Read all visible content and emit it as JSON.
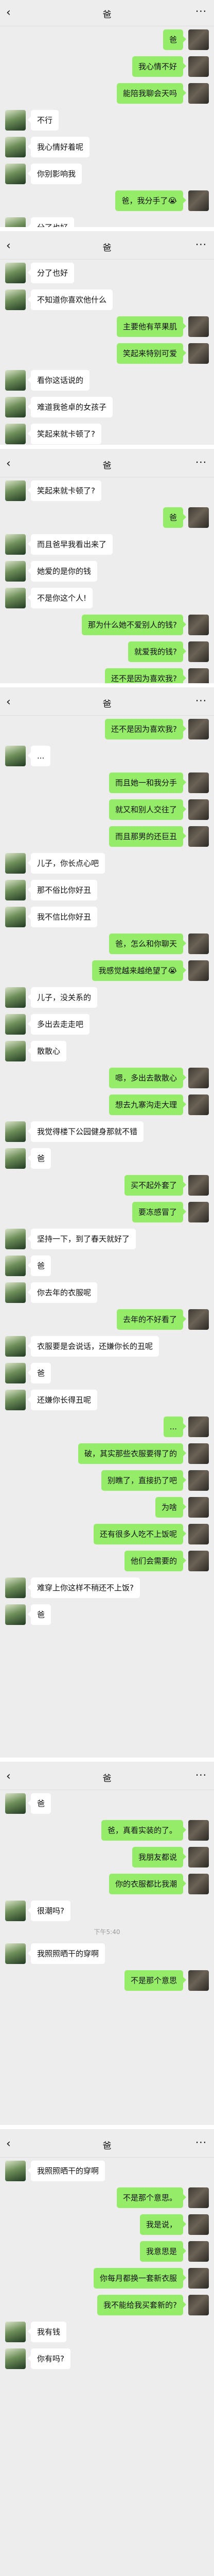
{
  "contact_name": "爸",
  "back_icon": "back-chevron-icon",
  "more_icon": "more-dots-icon",
  "screens": [
    {
      "messages": [
        {
          "side": "right",
          "text": "爸"
        },
        {
          "side": "right",
          "text": "我心情不好"
        },
        {
          "side": "right",
          "text": "能陪我聊会天吗"
        },
        {
          "side": "left",
          "text": "不行"
        },
        {
          "side": "left",
          "text": "我心情好着呢"
        },
        {
          "side": "left",
          "text": "你别影响我"
        },
        {
          "side": "right",
          "text": "爸，我分手了😭"
        },
        {
          "side": "left",
          "text": "分了也好"
        }
      ]
    },
    {
      "messages": [
        {
          "side": "left",
          "text": "分了也好"
        },
        {
          "side": "left",
          "text": "不知道你喜欢他什么"
        },
        {
          "side": "right",
          "text": "主要他有苹果肌"
        },
        {
          "side": "right",
          "text": "笑起来特别可爱"
        },
        {
          "side": "left",
          "text": "看你这话说的"
        },
        {
          "side": "left",
          "text": "难道我爸卓的女孩子"
        },
        {
          "side": "left",
          "text": "笑起来就卡顿了?"
        }
      ]
    },
    {
      "messages": [
        {
          "side": "left",
          "text": "笑起来就卡顿了?"
        },
        {
          "side": "right",
          "text": "爸"
        },
        {
          "side": "left",
          "text": "而且爸早我看出来了"
        },
        {
          "side": "left",
          "text": "她爱的是你的钱"
        },
        {
          "side": "left",
          "text": "不是你这个人!"
        },
        {
          "side": "right",
          "text": "那为什么她不爱别人的钱?"
        },
        {
          "side": "right",
          "text": "就爱我的钱?"
        },
        {
          "side": "right",
          "text": "还不是因为喜欢我?"
        }
      ]
    },
    {
      "messages": [
        {
          "side": "right",
          "text": "还不是因为喜欢我?"
        },
        {
          "side": "left",
          "text": "..."
        },
        {
          "side": "right",
          "text": "而且她一和我分手"
        },
        {
          "side": "right",
          "text": "就又和别人交往了"
        },
        {
          "side": "right",
          "text": "而且那男的还巨丑"
        },
        {
          "side": "left",
          "text": "儿子，你长点心吧"
        },
        {
          "side": "left",
          "text": "那不俗比你好丑"
        },
        {
          "side": "left",
          "text": "我不信比你好丑"
        },
        {
          "side": "right",
          "text": "爸，怎么和你聊天"
        },
        {
          "side": "right",
          "text": "我感觉越来越绝望了😭"
        },
        {
          "side": "left",
          "text": "儿子，没关系的"
        },
        {
          "side": "left",
          "text": "多出去走走吧"
        },
        {
          "side": "left",
          "text": "散散心"
        },
        {
          "side": "right",
          "text": "嗯，多出去散散心"
        },
        {
          "side": "right",
          "text": "想去九寨沟走大理"
        },
        {
          "side": "left",
          "text": "我觉得楼下公园健身那就不错"
        },
        {
          "side": "left",
          "text": "爸"
        },
        {
          "side": "right",
          "text": "买不起外套了"
        },
        {
          "side": "right",
          "text": "要冻感冒了"
        },
        {
          "side": "left",
          "text": "坚持一下，到了春天就好了"
        },
        {
          "side": "left",
          "text": "爸"
        },
        {
          "side": "left",
          "text": "你去年的衣服呢"
        },
        {
          "side": "right",
          "text": "去年的不好看了"
        },
        {
          "side": "left",
          "text": "衣服要是会说话，还嫌你长的丑呢"
        },
        {
          "side": "left",
          "text": "爸"
        },
        {
          "side": "left",
          "text": "还嫌你长得丑呢"
        },
        {
          "side": "right",
          "text": "..."
        },
        {
          "side": "right",
          "text": "破，其实那些衣服要得了的"
        },
        {
          "side": "right",
          "text": "别瞧了，直接扔了吧"
        },
        {
          "side": "right",
          "text": "为啥"
        },
        {
          "side": "right",
          "text": "还有很多人吃不上饭呢"
        },
        {
          "side": "right",
          "text": "他们会需要的"
        },
        {
          "side": "left",
          "text": "难穿上你这样不稍还不上饭?"
        },
        {
          "side": "left",
          "text": "爸"
        }
      ]
    },
    {
      "messages": [
        {
          "side": "left",
          "text": "爸"
        },
        {
          "side": "right",
          "text": "爸，真看实装的了。"
        },
        {
          "side": "right",
          "text": "我朋友都说"
        },
        {
          "side": "right",
          "text": "你的衣服都比我潮"
        },
        {
          "side": "left",
          "text": "很潮吗?"
        }
      ],
      "time": "下午5:40",
      "after": [
        {
          "side": "left",
          "text": "我照照晒干的穿啊"
        },
        {
          "side": "right",
          "text": "不是那个意思"
        }
      ]
    },
    {
      "messages": [
        {
          "side": "left",
          "text": "我照照晒干的穿啊"
        },
        {
          "side": "right",
          "text": "不是那个意思。"
        },
        {
          "side": "right",
          "text": "我是说，"
        },
        {
          "side": "right",
          "text": "我意思是"
        },
        {
          "side": "right",
          "text": "你每月都换一套新衣服"
        },
        {
          "side": "right",
          "text": "我不能给我买套新的?"
        },
        {
          "side": "left",
          "text": "我有钱"
        },
        {
          "side": "left",
          "text": "你有吗?"
        }
      ]
    }
  ]
}
